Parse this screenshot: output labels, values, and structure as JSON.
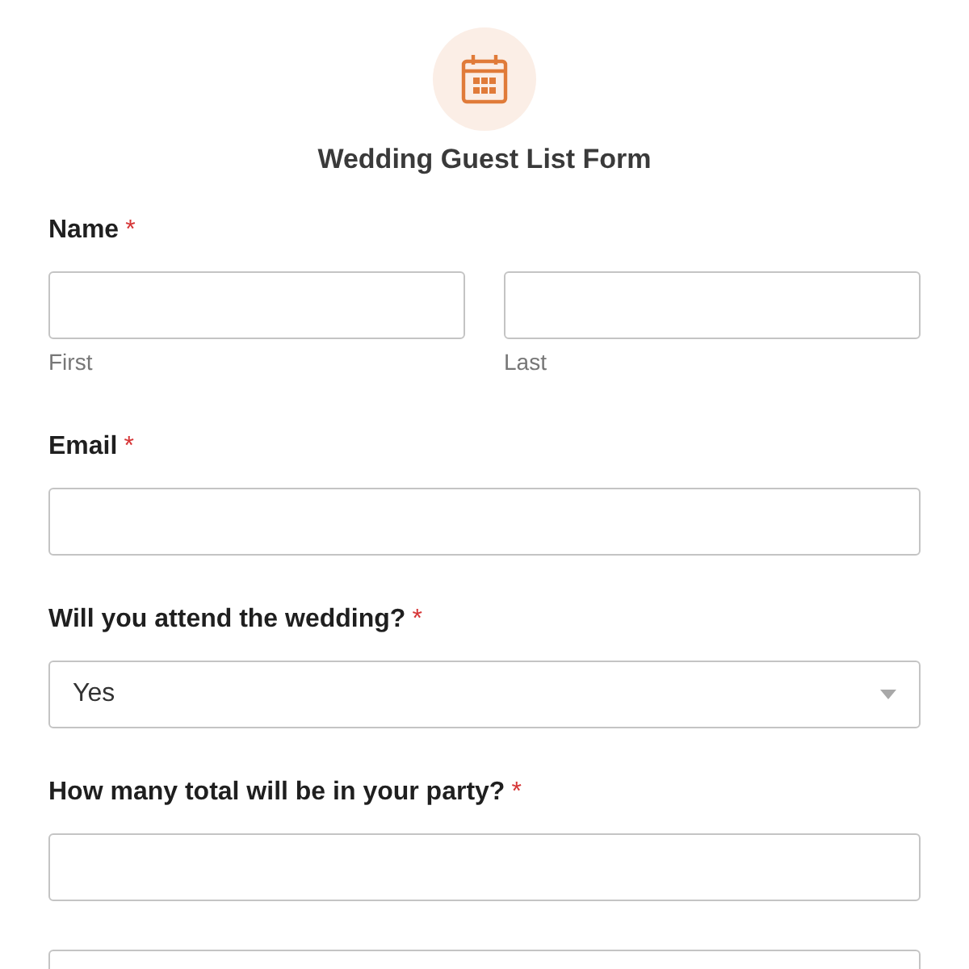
{
  "form": {
    "title": "Wedding Guest List Form"
  },
  "fields": [
    {
      "kind": "name",
      "label": "Name",
      "required_mark": "*",
      "sublabels": [
        "First",
        "Last"
      ]
    },
    {
      "kind": "text",
      "label": "Email",
      "required_mark": "*"
    },
    {
      "kind": "select",
      "label": "Will you attend the wedding?",
      "required_mark": "*",
      "value": "Yes"
    },
    {
      "kind": "text",
      "label": "How many total will be in your party?",
      "required_mark": "*"
    },
    {
      "kind": "text"
    }
  ]
}
